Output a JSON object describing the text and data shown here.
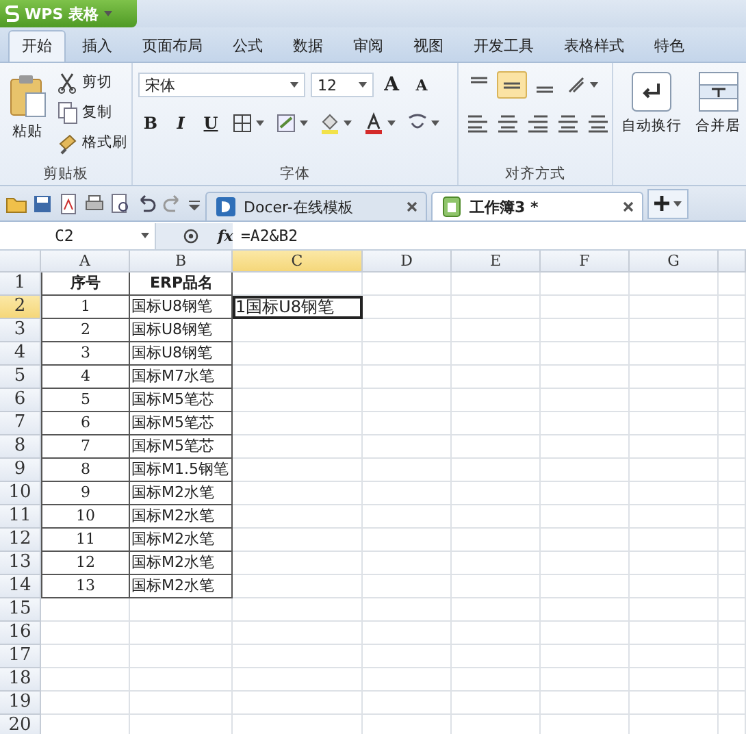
{
  "app": {
    "title": "WPS 表格"
  },
  "menu_tabs": [
    {
      "label": "开始",
      "selected": true
    },
    {
      "label": "插入",
      "selected": false
    },
    {
      "label": "页面布局",
      "selected": false
    },
    {
      "label": "公式",
      "selected": false
    },
    {
      "label": "数据",
      "selected": false
    },
    {
      "label": "审阅",
      "selected": false
    },
    {
      "label": "视图",
      "selected": false
    },
    {
      "label": "开发工具",
      "selected": false
    },
    {
      "label": "表格样式",
      "selected": false
    },
    {
      "label": "特色",
      "selected": false
    }
  ],
  "ribbon": {
    "clipboard": {
      "label": "剪贴板",
      "paste": "粘贴",
      "actions": [
        "剪切",
        "复制",
        "格式刷"
      ]
    },
    "font": {
      "label": "字体",
      "font_name": "宋体",
      "font_size": "12",
      "grow": "A",
      "shrink": "A",
      "styles": [
        "B",
        "I",
        "U"
      ]
    },
    "alignment": {
      "label": "对齐方式",
      "vertical_buttons": [
        {
          "selected": false
        },
        {
          "selected": true
        },
        {
          "selected": false
        }
      ]
    },
    "wrap": "自动换行",
    "merge": "合并居"
  },
  "doc_tabs": [
    {
      "label": "Docer-在线模板",
      "selected": false
    },
    {
      "label": "工作簿3 *",
      "selected": true
    }
  ],
  "formula_bar": {
    "name_box": "C2",
    "fx": "fx",
    "formula": "=A2&B2"
  },
  "sheet": {
    "columns": [
      {
        "label": "A",
        "selected": false
      },
      {
        "label": "B",
        "selected": false
      },
      {
        "label": "C",
        "selected": true
      },
      {
        "label": "D",
        "selected": false
      },
      {
        "label": "E",
        "selected": false
      },
      {
        "label": "F",
        "selected": false
      },
      {
        "label": "G",
        "selected": false
      }
    ],
    "rows": [
      {
        "header": "1",
        "selected": false,
        "cells": [
          {
            "text": "序号",
            "selected": false
          },
          {
            "text": "ERP品名",
            "selected": false
          }
        ]
      },
      {
        "header": "2",
        "selected": true,
        "cells": [
          {
            "text": "1",
            "selected": false
          },
          {
            "text": "国标U8钢笔",
            "selected": false
          },
          {
            "text": "1国标U8钢笔",
            "selected": true
          }
        ]
      },
      {
        "header": "3",
        "selected": false,
        "cells": [
          {
            "text": "2",
            "selected": false
          },
          {
            "text": "国标U8钢笔",
            "selected": false
          }
        ]
      },
      {
        "header": "4",
        "selected": false,
        "cells": [
          {
            "text": "3",
            "selected": false
          },
          {
            "text": "国标U8钢笔",
            "selected": false
          }
        ]
      },
      {
        "header": "5",
        "selected": false,
        "cells": [
          {
            "text": "4",
            "selected": false
          },
          {
            "text": "国标M7水笔",
            "selected": false
          }
        ]
      },
      {
        "header": "6",
        "selected": false,
        "cells": [
          {
            "text": "5",
            "selected": false
          },
          {
            "text": "国标M5笔芯",
            "selected": false
          }
        ]
      },
      {
        "header": "7",
        "selected": false,
        "cells": [
          {
            "text": "6",
            "selected": false
          },
          {
            "text": "国标M5笔芯",
            "selected": false
          }
        ]
      },
      {
        "header": "8",
        "selected": false,
        "cells": [
          {
            "text": "7",
            "selected": false
          },
          {
            "text": "国标M5笔芯",
            "selected": false
          }
        ]
      },
      {
        "header": "9",
        "selected": false,
        "cells": [
          {
            "text": "8",
            "selected": false
          },
          {
            "text": "国标M1.5钢笔",
            "selected": false
          }
        ]
      },
      {
        "header": "10",
        "selected": false,
        "cells": [
          {
            "text": "9",
            "selected": false
          },
          {
            "text": "国标M2水笔",
            "selected": false
          }
        ]
      },
      {
        "header": "11",
        "selected": false,
        "cells": [
          {
            "text": "10",
            "selected": false
          },
          {
            "text": "国标M2水笔",
            "selected": false
          }
        ]
      },
      {
        "header": "12",
        "selected": false,
        "cells": [
          {
            "text": "11",
            "selected": false
          },
          {
            "text": "国标M2水笔",
            "selected": false
          }
        ]
      },
      {
        "header": "13",
        "selected": false,
        "cells": [
          {
            "text": "12",
            "selected": false
          },
          {
            "text": "国标M2水笔",
            "selected": false
          }
        ]
      },
      {
        "header": "14",
        "selected": false,
        "cells": [
          {
            "text": "13",
            "selected": false
          },
          {
            "text": "国标M2水笔",
            "selected": false
          }
        ]
      },
      {
        "header": "15",
        "selected": false
      },
      {
        "header": "16",
        "selected": false
      },
      {
        "header": "17",
        "selected": false
      },
      {
        "header": "18",
        "selected": false
      },
      {
        "header": "19",
        "selected": false
      },
      {
        "header": "20",
        "selected": false
      }
    ]
  }
}
